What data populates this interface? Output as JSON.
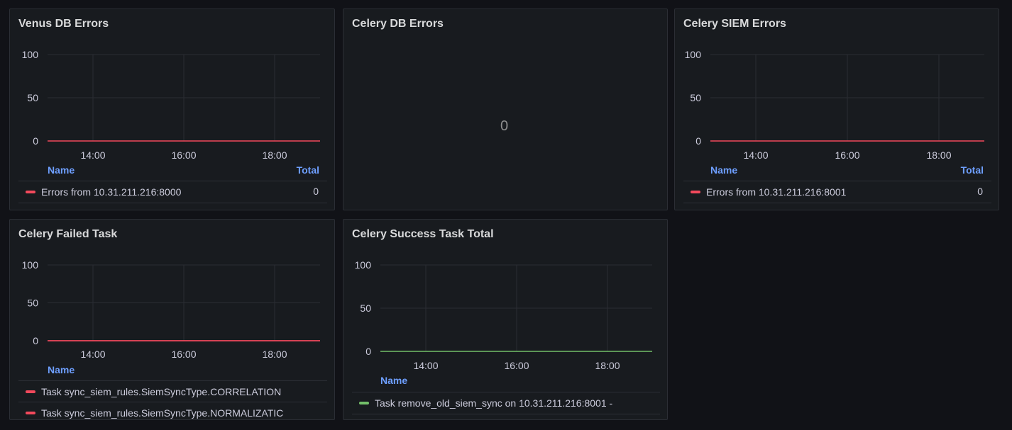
{
  "colors": {
    "error": "#f2495c",
    "success": "#73bf69"
  },
  "panels": {
    "venus_db": {
      "title": "Venus DB Errors",
      "legend_header_name": "Name",
      "legend_header_total": "Total",
      "legend": [
        {
          "label": "Errors from 10.31.211.216:8000",
          "total": "0"
        }
      ]
    },
    "celery_db": {
      "title": "Celery DB Errors",
      "value": "0"
    },
    "celery_siem": {
      "title": "Celery SIEM Errors",
      "legend_header_name": "Name",
      "legend_header_total": "Total",
      "legend": [
        {
          "label": "Errors from 10.31.211.216:8001",
          "total": "0"
        }
      ]
    },
    "celery_failed": {
      "title": "Celery Failed Task",
      "legend_header_name": "Name",
      "legend": [
        {
          "label": "Task sync_siem_rules.SiemSyncType.CORRELATION"
        },
        {
          "label": "Task sync_siem_rules.SiemSyncType.NORMALIZATIC"
        }
      ]
    },
    "celery_success": {
      "title": "Celery Success Task Total",
      "legend_header_name": "Name",
      "legend": [
        {
          "label": "Task remove_old_siem_sync on 10.31.211.216:8001 -"
        }
      ]
    }
  },
  "chart_data": [
    {
      "panel": "Venus DB Errors",
      "type": "line",
      "y_ticks": [
        "100",
        "50",
        "0"
      ],
      "x_ticks": [
        "14:00",
        "16:00",
        "18:00"
      ],
      "ylim": [
        0,
        100
      ],
      "series": [
        {
          "name": "Errors from 10.31.211.216:8000",
          "values": [
            0,
            0,
            0,
            0
          ],
          "color": "#f2495c"
        }
      ]
    },
    {
      "panel": "Celery SIEM Errors",
      "type": "line",
      "y_ticks": [
        "100",
        "50",
        "0"
      ],
      "x_ticks": [
        "14:00",
        "16:00",
        "18:00"
      ],
      "ylim": [
        0,
        100
      ],
      "series": [
        {
          "name": "Errors from 10.31.211.216:8001",
          "values": [
            0,
            0,
            0,
            0
          ],
          "color": "#f2495c"
        }
      ]
    },
    {
      "panel": "Celery Failed Task",
      "type": "line",
      "y_ticks": [
        "100",
        "50",
        "0"
      ],
      "x_ticks": [
        "14:00",
        "16:00",
        "18:00"
      ],
      "ylim": [
        0,
        100
      ],
      "series": [
        {
          "name": "Task sync_siem_rules.SiemSyncType.CORRELATION",
          "values": [
            0,
            0,
            0,
            0
          ],
          "color": "#f2495c"
        },
        {
          "name": "Task sync_siem_rules.SiemSyncType.NORMALIZATIC",
          "values": [
            0,
            0,
            0,
            0
          ],
          "color": "#f2495c"
        }
      ]
    },
    {
      "panel": "Celery Success Task Total",
      "type": "line",
      "y_ticks": [
        "100",
        "50",
        "0"
      ],
      "x_ticks": [
        "14:00",
        "16:00",
        "18:00"
      ],
      "ylim": [
        0,
        100
      ],
      "series": [
        {
          "name": "Task remove_old_siem_sync on 10.31.211.216:8001 -",
          "values": [
            0,
            0,
            0,
            0
          ],
          "color": "#73bf69"
        }
      ]
    }
  ]
}
